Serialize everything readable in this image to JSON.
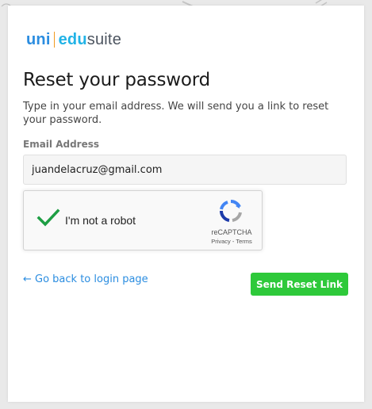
{
  "logo": {
    "part1": "uni",
    "part2": "edu",
    "part3": "suite"
  },
  "page": {
    "title": "Reset your password",
    "description": "Type in your email address. We will send you a link to reset your password."
  },
  "form": {
    "email_label": "Email Address",
    "email_value": "juandelacruz@gmail.com"
  },
  "recaptcha": {
    "label": "I'm not a robot",
    "brand": "reCAPTCHA",
    "privacy": "Privacy",
    "separator": " - ",
    "terms": "Terms",
    "checked": true
  },
  "actions": {
    "back_label": "← Go back to login page",
    "send_label": "Send Reset Link"
  },
  "colors": {
    "accent": "#2b8de0",
    "button": "#2ec93a",
    "check": "#1e9e44"
  },
  "icons": {
    "check": "checkmark-icon",
    "recaptcha": "recaptcha-logo-icon"
  }
}
